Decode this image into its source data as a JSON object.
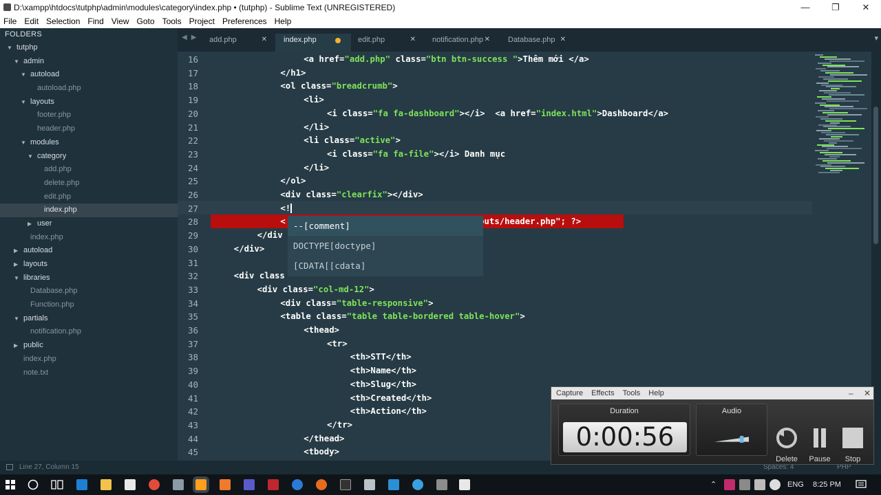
{
  "window": {
    "title": "D:\\xampp\\htdocs\\tutphp\\admin\\modules\\category\\index.php • (tutphp) - Sublime Text (UNREGISTERED)",
    "minimize": "—",
    "maximize": "❐",
    "close": "✕"
  },
  "menu": [
    "File",
    "Edit",
    "Selection",
    "Find",
    "View",
    "Goto",
    "Tools",
    "Project",
    "Preferences",
    "Help"
  ],
  "sidebar": {
    "header": "FOLDERS",
    "items": [
      {
        "label": "tutphp",
        "type": "folder",
        "depth": 0,
        "open": true
      },
      {
        "label": "admin",
        "type": "folder",
        "depth": 1,
        "open": true
      },
      {
        "label": "autoload",
        "type": "folder",
        "depth": 2,
        "open": true
      },
      {
        "label": "autoload.php",
        "type": "file",
        "depth": 3
      },
      {
        "label": "layouts",
        "type": "folder",
        "depth": 2,
        "open": true
      },
      {
        "label": "footer.php",
        "type": "file",
        "depth": 3
      },
      {
        "label": "header.php",
        "type": "file",
        "depth": 3
      },
      {
        "label": "modules",
        "type": "folder",
        "depth": 2,
        "open": true
      },
      {
        "label": "category",
        "type": "folder",
        "depth": 3,
        "open": true
      },
      {
        "label": "add.php",
        "type": "file",
        "depth": 4
      },
      {
        "label": "delete.php",
        "type": "file",
        "depth": 4
      },
      {
        "label": "edit.php",
        "type": "file",
        "depth": 4
      },
      {
        "label": "index.php",
        "type": "file",
        "depth": 4,
        "selected": true
      },
      {
        "label": "user",
        "type": "folder",
        "depth": 3,
        "open": false
      },
      {
        "label": "index.php",
        "type": "file",
        "depth": 2
      },
      {
        "label": "autoload",
        "type": "folder",
        "depth": 1,
        "open": false
      },
      {
        "label": "layouts",
        "type": "folder",
        "depth": 1,
        "open": false
      },
      {
        "label": "libraries",
        "type": "folder",
        "depth": 1,
        "open": true
      },
      {
        "label": "Database.php",
        "type": "file",
        "depth": 2
      },
      {
        "label": "Function.php",
        "type": "file",
        "depth": 2
      },
      {
        "label": "partials",
        "type": "folder",
        "depth": 1,
        "open": true
      },
      {
        "label": "notification.php",
        "type": "file",
        "depth": 2
      },
      {
        "label": "public",
        "type": "folder",
        "depth": 1,
        "open": false
      },
      {
        "label": "index.php",
        "type": "file",
        "depth": 1
      },
      {
        "label": "note.txt",
        "type": "file",
        "depth": 1
      }
    ]
  },
  "tabs": [
    {
      "label": "add.php",
      "active": false,
      "dirty": false
    },
    {
      "label": "index.php",
      "active": true,
      "dirty": true
    },
    {
      "label": "edit.php",
      "active": false,
      "dirty": false
    },
    {
      "label": "notification.php",
      "active": false,
      "dirty": false
    },
    {
      "label": "Database.php",
      "active": false,
      "dirty": false
    }
  ],
  "code": [
    {
      "n": "16",
      "ind": 16,
      "parts": [
        [
          "t",
          "<a href="
        ],
        [
          "s",
          "\"add.php\""
        ],
        [
          "t",
          " class="
        ],
        [
          "s",
          "\"btn btn-success \""
        ],
        [
          "t",
          ">Thêm mới </a>"
        ]
      ]
    },
    {
      "n": "17",
      "ind": 12,
      "parts": [
        [
          "t",
          "</h1>"
        ]
      ]
    },
    {
      "n": "18",
      "ind": 12,
      "parts": [
        [
          "t",
          "<ol class="
        ],
        [
          "s",
          "\"breadcrumb\""
        ],
        [
          "t",
          ">"
        ]
      ]
    },
    {
      "n": "19",
      "ind": 16,
      "parts": [
        [
          "t",
          "<li>"
        ]
      ]
    },
    {
      "n": "20",
      "ind": 20,
      "parts": [
        [
          "t",
          "<i class="
        ],
        [
          "s",
          "\"fa fa-dashboard\""
        ],
        [
          "t",
          "></i>  <a href="
        ],
        [
          "s",
          "\"index.html\""
        ],
        [
          "t",
          ">Dashboard</a>"
        ]
      ]
    },
    {
      "n": "21",
      "ind": 16,
      "parts": [
        [
          "t",
          "</li>"
        ]
      ]
    },
    {
      "n": "22",
      "ind": 16,
      "parts": [
        [
          "t",
          "<li class="
        ],
        [
          "s",
          "\"active\""
        ],
        [
          "t",
          ">"
        ]
      ]
    },
    {
      "n": "23",
      "ind": 20,
      "parts": [
        [
          "t",
          "<i class="
        ],
        [
          "s",
          "\"fa fa-file\""
        ],
        [
          "t",
          "></i> Danh mục"
        ]
      ]
    },
    {
      "n": "24",
      "ind": 16,
      "parts": [
        [
          "t",
          "</li>"
        ]
      ]
    },
    {
      "n": "25",
      "ind": 12,
      "parts": [
        [
          "t",
          "</ol>"
        ]
      ]
    },
    {
      "n": "26",
      "ind": 12,
      "parts": [
        [
          "t",
          "<div class="
        ],
        [
          "s",
          "\"clearfix\""
        ],
        [
          "t",
          "></div>"
        ]
      ]
    },
    {
      "n": "27",
      "ind": 12,
      "parts": [
        [
          "t",
          "<!"
        ]
      ],
      "cursor": true
    },
    {
      "n": "28",
      "ind": 12,
      "parts": [
        [
          "t",
          "<                                  /layouts/header.php\"; ?>"
        ]
      ],
      "error": true
    },
    {
      "n": "29",
      "ind": 8,
      "parts": [
        [
          "t",
          "</div"
        ]
      ]
    },
    {
      "n": "30",
      "ind": 4,
      "parts": [
        [
          "t",
          "</div>"
        ]
      ]
    },
    {
      "n": "31",
      "ind": 0,
      "parts": []
    },
    {
      "n": "32",
      "ind": 4,
      "parts": [
        [
          "t",
          "<div class"
        ]
      ]
    },
    {
      "n": "33",
      "ind": 8,
      "parts": [
        [
          "t",
          "<div class="
        ],
        [
          "s",
          "\"col-md-12\""
        ],
        [
          "t",
          ">"
        ]
      ]
    },
    {
      "n": "34",
      "ind": 12,
      "parts": [
        [
          "t",
          "<div class="
        ],
        [
          "s",
          "\"table-responsive\""
        ],
        [
          "t",
          ">"
        ]
      ]
    },
    {
      "n": "35",
      "ind": 12,
      "parts": [
        [
          "t",
          "<table class="
        ],
        [
          "s",
          "\"table table-bordered table-hover\""
        ],
        [
          "t",
          ">"
        ]
      ]
    },
    {
      "n": "36",
      "ind": 16,
      "parts": [
        [
          "t",
          "<thead>"
        ]
      ]
    },
    {
      "n": "37",
      "ind": 20,
      "parts": [
        [
          "t",
          "<tr>"
        ]
      ]
    },
    {
      "n": "38",
      "ind": 24,
      "parts": [
        [
          "t",
          "<th>STT</th>"
        ]
      ]
    },
    {
      "n": "39",
      "ind": 24,
      "parts": [
        [
          "t",
          "<th>Name</th>"
        ]
      ]
    },
    {
      "n": "40",
      "ind": 24,
      "parts": [
        [
          "t",
          "<th>Slug</th>"
        ]
      ]
    },
    {
      "n": "41",
      "ind": 24,
      "parts": [
        [
          "t",
          "<th>Created</th>"
        ]
      ]
    },
    {
      "n": "42",
      "ind": 24,
      "parts": [
        [
          "t",
          "<th>Action</th>"
        ]
      ]
    },
    {
      "n": "43",
      "ind": 20,
      "parts": [
        [
          "t",
          "</tr>"
        ]
      ]
    },
    {
      "n": "44",
      "ind": 16,
      "parts": [
        [
          "t",
          "</thead>"
        ]
      ]
    },
    {
      "n": "45",
      "ind": 16,
      "parts": [
        [
          "t",
          "<tbody>"
        ]
      ]
    }
  ],
  "autocomplete": [
    "--[comment]",
    "DOCTYPE[doctype]",
    "[CDATA[[cdata]"
  ],
  "status": {
    "position": "Line 27, Column 15",
    "spaces": "Spaces: 4",
    "syntax": "PHP"
  },
  "recorder": {
    "menu": [
      "Capture",
      "Effects",
      "Tools",
      "Help"
    ],
    "duration_label": "Duration",
    "duration": "0:00:56",
    "audio_label": "Audio",
    "audio_level": 0.85,
    "buttons": [
      "Delete",
      "Pause",
      "Stop"
    ]
  },
  "taskbar": {
    "lang": "ENG",
    "time": "8:25 PM"
  },
  "colors": {
    "editor_bg": "#263b45",
    "string": "#7ee35b",
    "error": "#b80e0e",
    "tab_dirty": "#f1b32d"
  }
}
